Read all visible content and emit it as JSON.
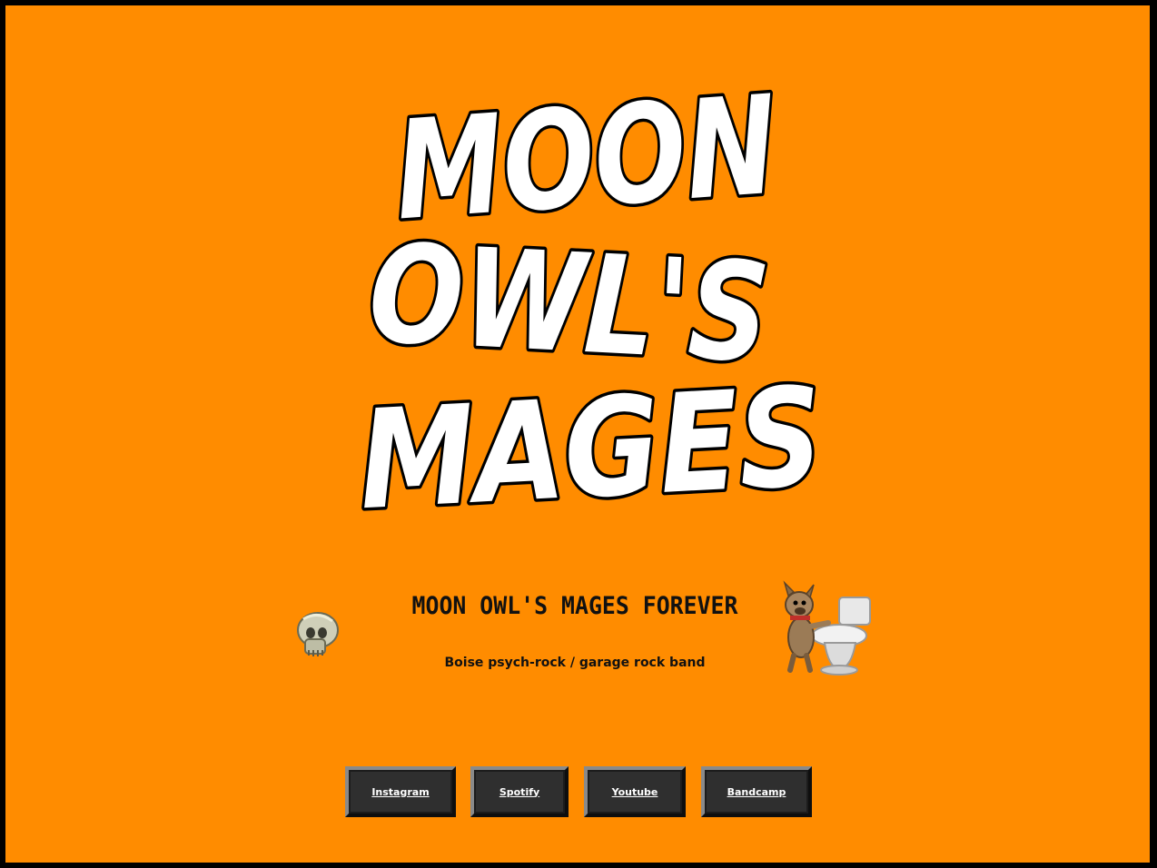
{
  "logo": {
    "lines": [
      "MOON",
      "OWL'S",
      "MAGES"
    ]
  },
  "headline": "MOON OWL'S MAGES FOREVER",
  "tagline": "Boise psych-rock / garage rock band",
  "nav": {
    "links": [
      {
        "label": "Instagram"
      },
      {
        "label": "Spotify"
      },
      {
        "label": "Youtube"
      },
      {
        "label": "Bandcamp"
      }
    ]
  },
  "icons": {
    "left": "skull-icon",
    "right": "dog-toilet-icon"
  },
  "colors": {
    "background": "#ff8c00",
    "frame": "#000000",
    "button": "#2f2f2f",
    "text": "#111111"
  }
}
